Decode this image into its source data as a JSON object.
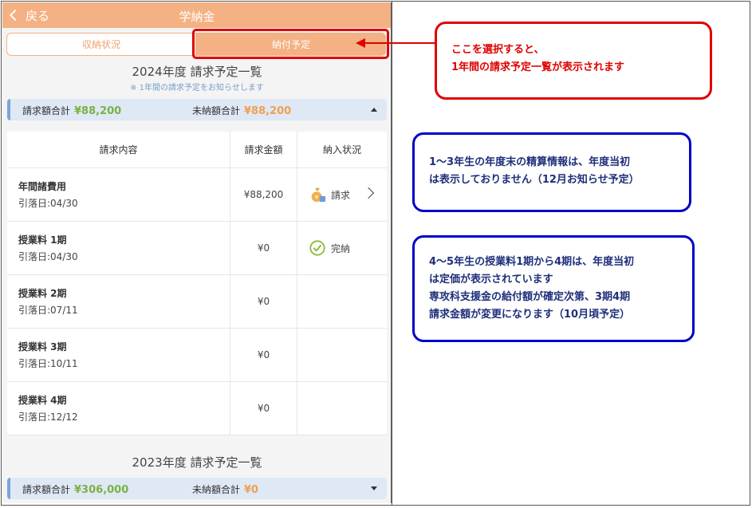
{
  "header": {
    "back_label": "戻る",
    "title": "学納金"
  },
  "tabs": [
    {
      "label": "収納状況",
      "active": false
    },
    {
      "label": "納付予定",
      "active": true
    }
  ],
  "year_2024": {
    "title": "2024年度 請求予定一覧",
    "note": "※ 1年間の請求予定をお知らせします",
    "billed_label": "請求額合計",
    "billed_value": "¥88,200",
    "unpaid_label": "未納額合計",
    "unpaid_value": "¥88,200"
  },
  "table": {
    "headers": [
      "請求内容",
      "請求金額",
      "納入状況"
    ],
    "rows": [
      {
        "name": "年間諸費用",
        "date": "引落日:04/30",
        "amount": "¥88,200",
        "status": "請求",
        "status_icon": "money-bag-icon",
        "has_chevron": true
      },
      {
        "name": "授業料 1期",
        "date": "引落日:04/30",
        "amount": "¥0",
        "status": "完納",
        "status_icon": "check-circle-icon",
        "has_chevron": false
      },
      {
        "name": "授業料 2期",
        "date": "引落日:07/11",
        "amount": "¥0",
        "status": "",
        "status_icon": "",
        "has_chevron": false
      },
      {
        "name": "授業料 3期",
        "date": "引落日:10/11",
        "amount": "¥0",
        "status": "",
        "status_icon": "",
        "has_chevron": false
      },
      {
        "name": "授業料 4期",
        "date": "引落日:12/12",
        "amount": "¥0",
        "status": "",
        "status_icon": "",
        "has_chevron": false
      }
    ]
  },
  "year_2023": {
    "title": "2023年度 請求予定一覧",
    "billed_label": "請求額合計",
    "billed_value": "¥306,000",
    "unpaid_label": "未納額合計",
    "unpaid_value": "¥0"
  },
  "callouts": {
    "red": [
      "ここを選択すると、",
      "1年間の請求予定一覧が表示されます"
    ],
    "blue1": [
      "1～3年生の年度末の精算情報は、年度当初",
      "は表示しておりません（12月お知らせ予定）"
    ],
    "blue2": [
      "4～5年生の授業料1期から4期は、年度当初",
      "は定価が表示されています",
      "専攻科支援金の給付額が確定次第、3期4期",
      "請求金額が変更になります（10月頃予定）"
    ]
  },
  "colors": {
    "header": "#f4b183",
    "green_amount": "#7bb143",
    "orange_amount": "#f0a050",
    "summary_bg": "#dfe8f5",
    "red_callout": "#e00000",
    "blue_callout": "#0000c8"
  }
}
